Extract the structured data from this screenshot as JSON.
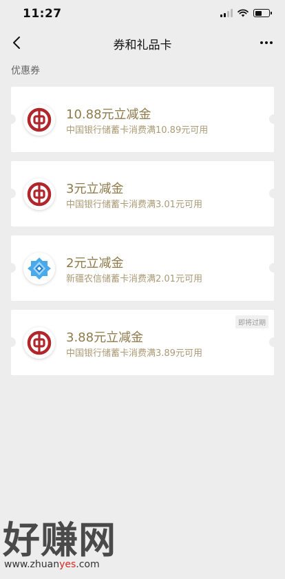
{
  "status_bar": {
    "time": "11:27"
  },
  "nav": {
    "title": "券和礼品卡"
  },
  "section": {
    "title": "优惠券"
  },
  "coupons": [
    {
      "title": "10.88元立减金",
      "subtitle": "中国银行储蓄卡消费满10.89元可用",
      "logo": "boc-logo-icon"
    },
    {
      "title": "3元立减金",
      "subtitle": "中国银行储蓄卡消费满3.01元可用",
      "logo": "boc-logo-icon"
    },
    {
      "title": "2元立减金",
      "subtitle": "新疆农信储蓄卡消费满2.01元可用",
      "logo": "xinjiang-rcc-logo-icon"
    },
    {
      "title": "3.88元立减金",
      "subtitle": "中国银行储蓄卡消费满3.89元可用",
      "logo": "boc-logo-icon",
      "badge": "即将过期"
    }
  ],
  "watermark": {
    "brand": "好赚网",
    "url_pre": "www.zhuan",
    "url_hl": "yes",
    "url_post": ".com"
  },
  "colors": {
    "accent_gold": "#8f7a4a",
    "boc_red": "#b1262b",
    "rcc_blue": "#4aa9e8"
  }
}
